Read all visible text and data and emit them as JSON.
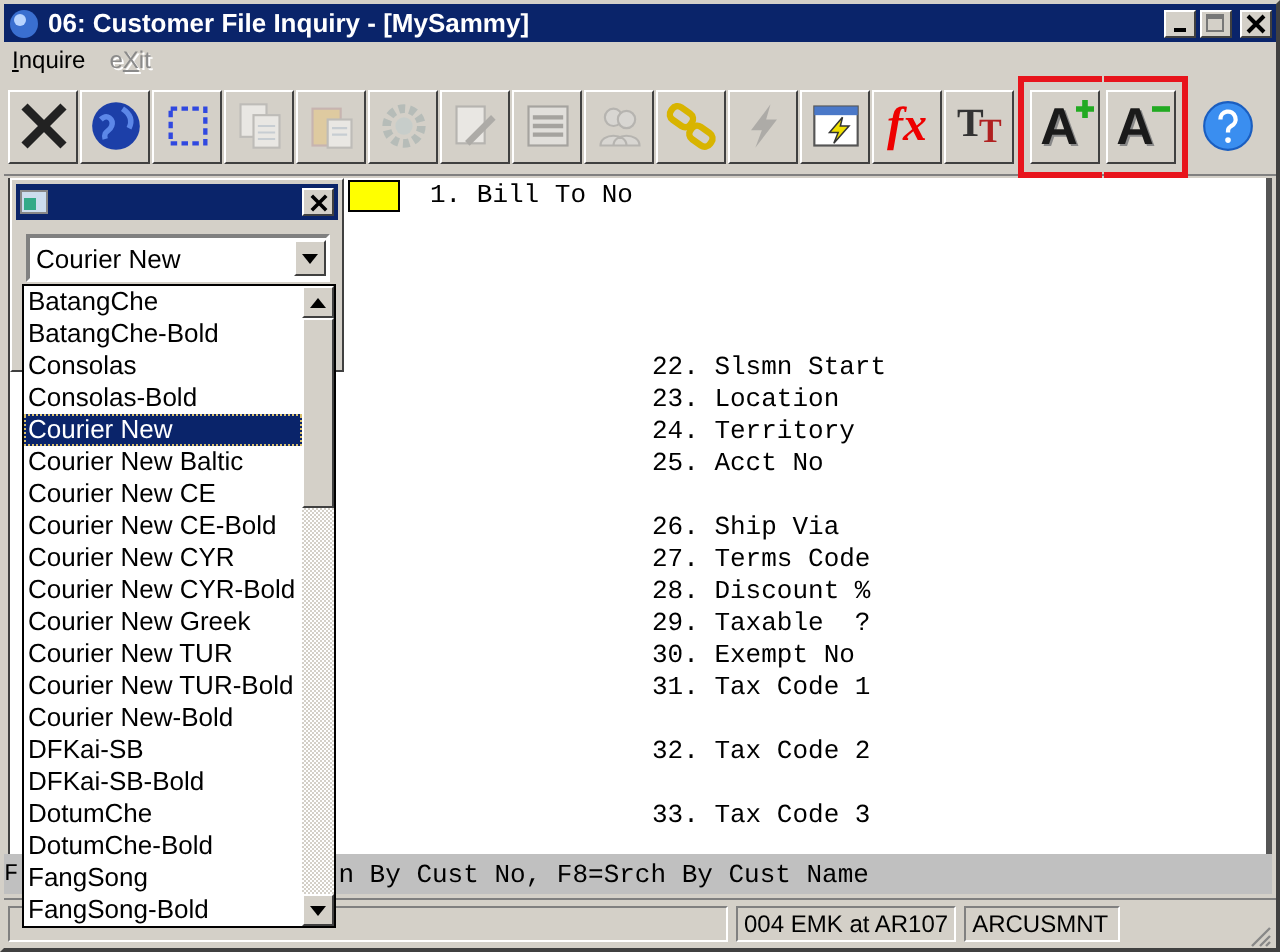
{
  "window": {
    "title": "06: Customer File Inquiry - [MySammy]"
  },
  "menu": [
    {
      "key": "I",
      "after": "nquire",
      "disabled": false
    },
    {
      "before": "e",
      "key": "X",
      "after": "it",
      "disabled": true
    }
  ],
  "toolbar": [
    {
      "kind": "close",
      "disabled": false,
      "highlighted": false
    },
    {
      "kind": "globe",
      "disabled": false,
      "highlighted": false
    },
    {
      "kind": "select",
      "disabled": false,
      "highlighted": false
    },
    {
      "kind": "copy",
      "disabled": true,
      "highlighted": false
    },
    {
      "kind": "paste",
      "disabled": true,
      "highlighted": false
    },
    {
      "kind": "gear",
      "disabled": true,
      "highlighted": false
    },
    {
      "kind": "edit",
      "disabled": true,
      "highlighted": false
    },
    {
      "kind": "list",
      "disabled": true,
      "highlighted": false
    },
    {
      "kind": "people",
      "disabled": true,
      "highlighted": false
    },
    {
      "kind": "chain",
      "disabled": false,
      "highlighted": false
    },
    {
      "kind": "lightning",
      "disabled": true,
      "highlighted": false
    },
    {
      "kind": "window",
      "disabled": false,
      "highlighted": false
    },
    {
      "kind": "text",
      "glyph": "fx",
      "disabled": false,
      "highlighted": false
    },
    {
      "kind": "fonts",
      "glyph": "TT",
      "disabled": false,
      "highlighted": false
    },
    {
      "kind": "bigger",
      "glyph": "A",
      "disabled": false,
      "highlighted": true
    },
    {
      "kind": "smaller",
      "glyph": "A",
      "disabled": false,
      "highlighted": true
    },
    {
      "kind": "help",
      "disabled": false,
      "highlighted": false
    }
  ],
  "form": {
    "first_field": "1. Bill To No",
    "field_groups": [
      [
        "22. Slsmn Start",
        "23. Location",
        "24. Territory",
        "25. Acct No"
      ],
      [
        "26. Ship Via",
        "27. Terms Code",
        "28. Discount %",
        "29. Taxable  ?",
        "30. Exempt No",
        "31. Tax Code 1"
      ],
      [
        "32. Tax Code 2"
      ],
      [
        "33. Tax Code 3"
      ]
    ]
  },
  "hint_bar": [
    "F",
    "n By Cust No, F8=Srch By Cust Name"
  ],
  "status_bar": [
    "004 EMK at AR107",
    "ARCUSMNT"
  ],
  "font_palette": {
    "value": "Courier New",
    "options": [
      {
        "label": "BatangChe",
        "selected": false
      },
      {
        "label": "BatangChe-Bold",
        "selected": false
      },
      {
        "label": "Consolas",
        "selected": false
      },
      {
        "label": "Consolas-Bold",
        "selected": false
      },
      {
        "label": "Courier New",
        "selected": true
      },
      {
        "label": "Courier New Baltic",
        "selected": false
      },
      {
        "label": "Courier New CE",
        "selected": false
      },
      {
        "label": "Courier New CE-Bold",
        "selected": false
      },
      {
        "label": "Courier New CYR",
        "selected": false
      },
      {
        "label": "Courier New CYR-Bold",
        "selected": false
      },
      {
        "label": "Courier New Greek",
        "selected": false
      },
      {
        "label": "Courier New TUR",
        "selected": false
      },
      {
        "label": "Courier New TUR-Bold",
        "selected": false
      },
      {
        "label": "Courier New-Bold",
        "selected": false
      },
      {
        "label": "DFKai-SB",
        "selected": false
      },
      {
        "label": "DFKai-SB-Bold",
        "selected": false
      },
      {
        "label": "DotumChe",
        "selected": false
      },
      {
        "label": "DotumChe-Bold",
        "selected": false
      },
      {
        "label": "FangSong",
        "selected": false
      },
      {
        "label": "FangSong-Bold",
        "selected": false
      }
    ]
  }
}
